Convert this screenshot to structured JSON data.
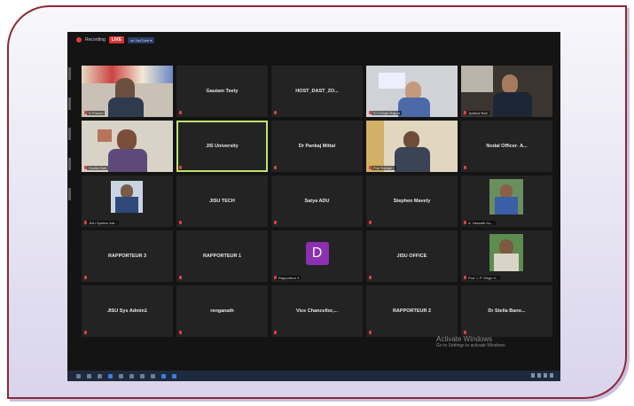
{
  "topbar": {
    "recording_label": "Recording",
    "live_badge": "LIVE",
    "viewers_label": "on YouTube ▾"
  },
  "tiles": [
    {
      "name": "",
      "label": "S Prasad",
      "type": "video",
      "scene": "banner"
    },
    {
      "name": "Gautam Teety",
      "type": "name"
    },
    {
      "name": "HOST_DAST_ZO...",
      "type": "name"
    },
    {
      "name": "",
      "label": "S.Y.Singh Rajput",
      "type": "video",
      "scene": "office"
    },
    {
      "name": "",
      "label": "Jyotikar Bali",
      "type": "video",
      "scene": "dark"
    },
    {
      "name": "",
      "label": "Sunita Mali",
      "type": "video",
      "scene": "woman"
    },
    {
      "name": "JIS University",
      "type": "name",
      "active": true
    },
    {
      "name": "Dr Pankaj Mittal",
      "type": "name"
    },
    {
      "name": "",
      "label": "Prof Ranjan...",
      "type": "video",
      "scene": "curtain"
    },
    {
      "name": "Nodal Officer- A...",
      "type": "name"
    },
    {
      "name": "",
      "label": "JNU System Adi...",
      "type": "video",
      "scene": "portrait"
    },
    {
      "name": "JISU TECH",
      "type": "name"
    },
    {
      "name": "Satya ADU",
      "type": "name"
    },
    {
      "name": "Stephen Mavely",
      "type": "name"
    },
    {
      "name": "",
      "label": "A. Vasanth Ku...",
      "type": "video",
      "scene": "portrait2"
    },
    {
      "name": "RAPPORTEUR 3",
      "type": "name"
    },
    {
      "name": "RAPPORTEUR 1",
      "type": "name"
    },
    {
      "name": "",
      "label": "Rapporteur 4",
      "type": "avatar",
      "initial": "D"
    },
    {
      "name": "JISU OFFICE",
      "type": "name"
    },
    {
      "name": "",
      "label": "Prof. L.P. Singh V...",
      "type": "video",
      "scene": "portrait3"
    },
    {
      "name": "JISU Sys Admin1",
      "type": "name"
    },
    {
      "name": "renganath",
      "type": "name"
    },
    {
      "name": "Vice Chancellor,...",
      "type": "name"
    },
    {
      "name": "RAPPORTEUR 2",
      "type": "name"
    },
    {
      "name": "Dr Stella Bano...",
      "type": "name"
    }
  ],
  "watermark": {
    "line1": "Activate Windows",
    "line2": "Go to Settings to activate Windows."
  },
  "colors": {
    "border": "#8b2a34",
    "active_outline": "#bfe36a",
    "avatar": "#8c2fb0",
    "live": "#d93636"
  }
}
